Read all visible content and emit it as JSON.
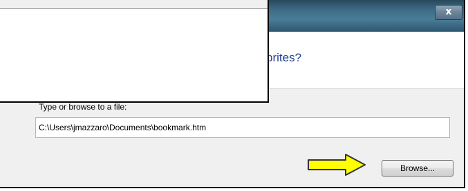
{
  "dialog": {
    "close_glyph": "x",
    "heading": "prites?",
    "file_label": "Type or browse to a file:",
    "file_path": "C:\\Users\\jmazzaro\\Documents\\bookmark.htm",
    "browse_label": "Browse..."
  },
  "annotation": {
    "arrow_icon": "right-arrow-icon",
    "arrow_fill": "#ffff00",
    "arrow_stroke": "#333333"
  }
}
